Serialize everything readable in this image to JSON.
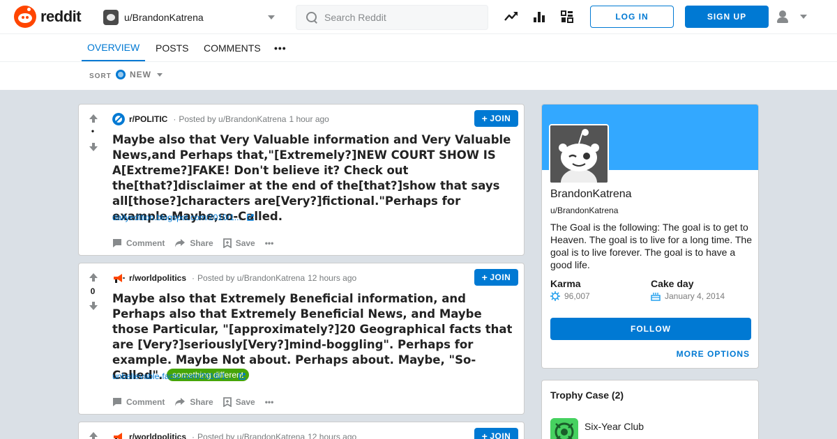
{
  "header": {
    "logo_text": "reddit",
    "user_dropdown_label": "u/BrandonKatrena",
    "search_placeholder": "Search Reddit",
    "login_label": "LOG IN",
    "signup_label": "SIGN UP",
    "brand_color": "#ff4500",
    "accent_color": "#0079d3"
  },
  "tabs": {
    "overview": "OVERVIEW",
    "posts": "POSTS",
    "comments": "COMMENTS",
    "more": "•••"
  },
  "sort": {
    "label": "SORT",
    "selected": "NEW"
  },
  "posts": [
    {
      "subreddit": "r/POLITIC",
      "posted_by": "Posted by u/BrandonKatrena",
      "time": "1 hour ago",
      "votes": "•",
      "join_label": "JOIN",
      "title": "Maybe also that Very Valuable information and Very Valuable News,and Perhaps that,\"[Extremely?]NEW COURT SHOW IS A[Extreme?]FAKE! Don't believe it? Check out the[that?]disclaimer at the end of the[that?]show that says all[those?]characters are[Very?]fictional.\"Perhaps for example.Maybe,so-Called.",
      "link": "dailyedition.blogspot.com/2010/1...",
      "actions": {
        "comment": "Comment",
        "share": "Share",
        "save": "Save",
        "more": "•••"
      }
    },
    {
      "subreddit": "r/worldpolitics",
      "posted_by": "Posted by u/BrandonKatrena",
      "time": "12 hours ago",
      "votes": "0",
      "join_label": "JOIN",
      "title": "Maybe also that Extremely Beneficial information, and Perhaps also that Extremely Beneficial News, and Maybe those Particular, \"[approximately?]20 Geographical facts that are [Very?]seriously[Very?]mind-boggling\". Perhaps for example. Maybe Not about. Perhaps about. Maybe, \"So-Called\".",
      "flair": "something different",
      "flair_color": "#46a508",
      "link": "unbelievable-facts.com/2016/1...",
      "actions": {
        "comment": "Comment",
        "share": "Share",
        "save": "Save",
        "more": "•••"
      }
    },
    {
      "subreddit": "r/worldpolitics",
      "posted_by": "Posted by u/BrandonKatrena",
      "time": "12 hours ago",
      "join_label": "JOIN"
    }
  ],
  "profile": {
    "display_name": "BrandonKatrena",
    "handle": "u/BrandonKatrena",
    "bio": "The Goal is the following: The goal is to get to Heaven. The goal is to live for a long time. The goal is to live forever. The goal is to have a good life.",
    "karma_label": "Karma",
    "karma_value": "96,007",
    "cakeday_label": "Cake day",
    "cakeday_value": "January 4, 2014",
    "follow_label": "FOLLOW",
    "more_options_label": "MORE OPTIONS",
    "banner_color": "#33a8ff"
  },
  "trophies": {
    "title": "Trophy Case (2)",
    "items": [
      {
        "name": "Six-Year Club"
      }
    ]
  }
}
